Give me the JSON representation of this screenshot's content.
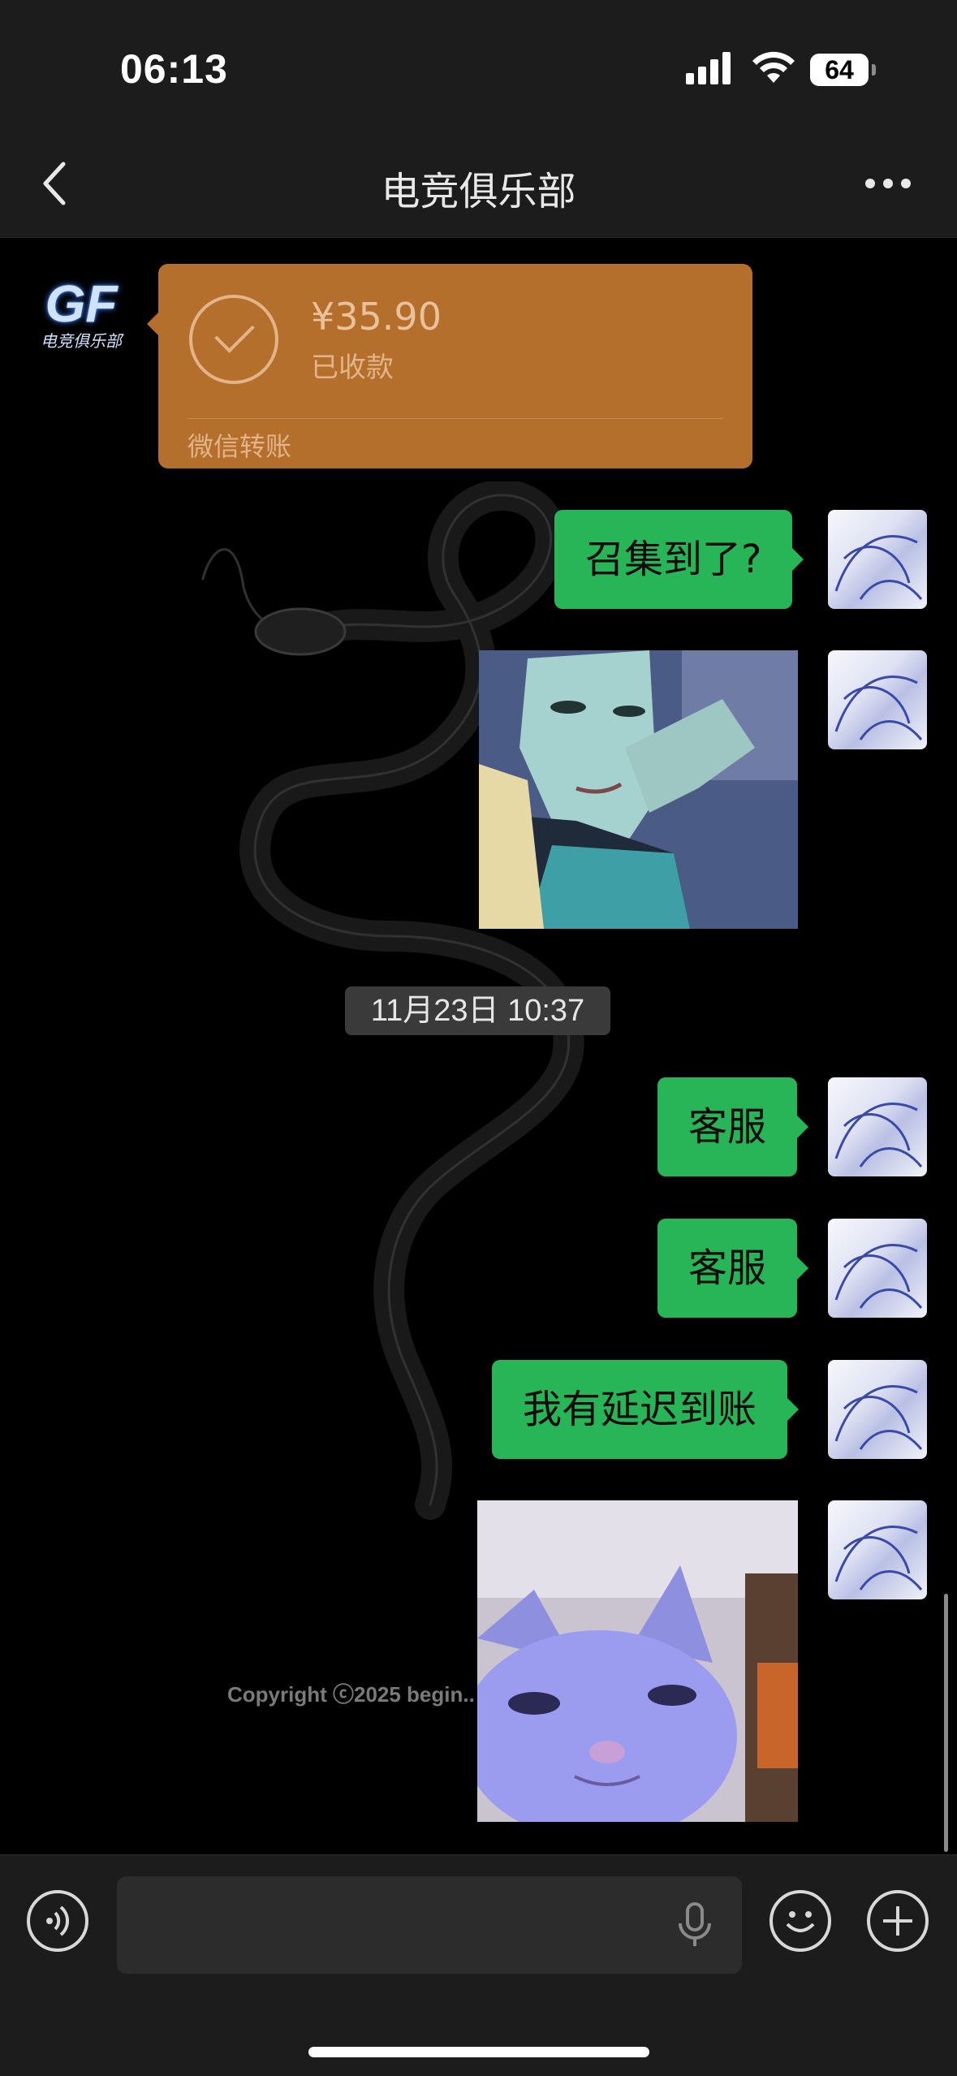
{
  "status_bar": {
    "time": "06:13",
    "battery": "64",
    "signal_bars": 4,
    "wifi": true
  },
  "header": {
    "title": "电竞俱乐部",
    "back_icon": "chevron-left-icon",
    "more_icon": "more-dots-icon"
  },
  "messages": {
    "transfer": {
      "amount": "¥35.90",
      "status": "已收款",
      "source": "微信转账"
    },
    "text_1": "召集到了?",
    "timestamp": "11月23日 10:37",
    "text_2": "客服",
    "text_3": "客服",
    "text_4": "我有延迟到账"
  },
  "watermark": {
    "copyright": "Copyright ⓒ2025 begin.."
  },
  "sender_avatar": {
    "logo_text": "GF",
    "logo_subtext": "电竞俱乐部"
  },
  "input_bar": {
    "voice_icon": "voice-mode-icon",
    "mic_icon": "microphone-icon",
    "emoji_icon": "emoji-icon",
    "plus_icon": "plus-icon"
  },
  "colors": {
    "bubble_green": "#27b558",
    "transfer_orange": "#b56f2c",
    "bar_bg": "#1c1c1c"
  }
}
